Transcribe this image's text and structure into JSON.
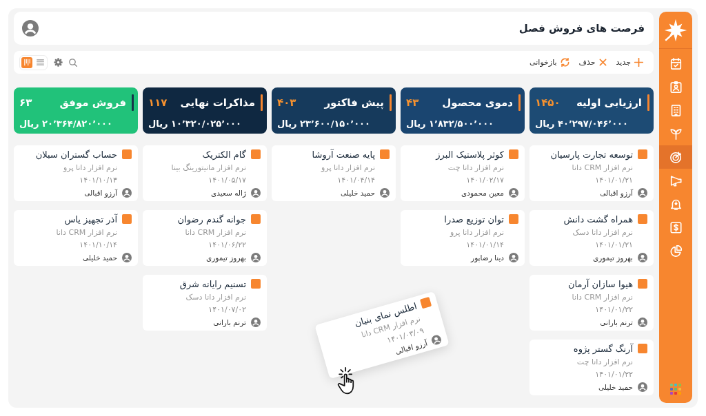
{
  "sidebar": {
    "items": [
      {
        "selected": false
      },
      {
        "selected": false
      },
      {
        "selected": false
      },
      {
        "selected": false
      },
      {
        "selected": true
      },
      {
        "selected": false
      },
      {
        "selected": false
      },
      {
        "selected": false
      },
      {
        "selected": false
      }
    ]
  },
  "header": {
    "title": "فرصت های فروش فصل"
  },
  "toolbar": {
    "actions": [
      {
        "label": "جدید"
      },
      {
        "label": "حذف"
      },
      {
        "label": "بازخوانی"
      }
    ],
    "views": [
      {
        "selected": false
      },
      {
        "selected": true
      }
    ]
  },
  "board": {
    "columns": [
      {
        "title": "ارزیابی اولیه",
        "count": "۱۴۵۰",
        "amount": "۴۰٬۲۹۷/۰۴۶٬۰۰۰ ریال",
        "color": "#1d4b74",
        "kind": "open",
        "cards": [
          {
            "title": "توسعه تجارت پارسیان",
            "product": "نرم افزار CRM دانا",
            "date": "۱۴۰۱/۰۱/۲۱",
            "owner": "آرزو اقبالی"
          },
          {
            "title": "همراه گشت دانش",
            "product": "نرم افزار دانا دسک",
            "date": "۱۴۰۱/۰۱/۲۱",
            "owner": "بهروز تیموری"
          },
          {
            "title": "هیوا سازان آرمان",
            "product": "نرم افزار CRM دانا",
            "date": "۱۴۰۱/۰۱/۲۲",
            "owner": "ترنم بارانی"
          },
          {
            "title": "آرنگ گستر پژوه",
            "product": "نرم افزار دانا چت",
            "date": "۱۴۰۱/۰۱/۲۲",
            "owner": "حمید خلیلی"
          }
        ]
      },
      {
        "title": "دموی محصول",
        "count": "۴۳",
        "amount": "۱٬۸۳۲/۵۰۰٬۰۰۰ ریال",
        "color": "#1a4570",
        "kind": "open",
        "cards": [
          {
            "title": "کوثر پلاستیک البرز",
            "product": "نرم افزار دانا چت",
            "date": "۱۴۰۱/۰۲/۱۷",
            "owner": "معین محمودی"
          },
          {
            "title": "توان توزیع صدرا",
            "product": "نرم افزار دانا پرو",
            "date": "۱۴۰۱/۰۱/۱۴",
            "owner": "دینا رضاپور"
          }
        ]
      },
      {
        "title": "پیش فاکتور",
        "count": "۴۰۳",
        "amount": "۲۳٬۶۰۰/۱۵۰٬۰۰۰ ریال",
        "color": "#163a5c",
        "kind": "open",
        "cards": [
          {
            "title": "پایه صنعت آروشا",
            "product": "نرم افزار دانا پرو",
            "date": "۱۴۰۱/۰۴/۱۴",
            "owner": "حمید خلیلی"
          }
        ]
      },
      {
        "title": "مذاکرات نهایی",
        "count": "۱۱۷",
        "amount": "۱۰٬۳۲۰/۰۲۵٬۰۰۰ ریال",
        "color": "#0f2841",
        "kind": "open",
        "cards": [
          {
            "title": "گام الکتریک",
            "product": "نرم افزار مانیتورینگ بینا",
            "date": "۱۴۰۱/۰۵/۱۷",
            "owner": "ژاله سعیدی"
          },
          {
            "title": "جوانه گندم رضوان",
            "product": "نرم افزار CRM دانا",
            "date": "۱۴۰۱/۰۶/۲۲",
            "owner": "بهروز تیموری"
          },
          {
            "title": "تسنیم رایانه شرق",
            "product": "نرم افزار دانا دسک",
            "date": "۱۴۰۱/۰۷/۰۲",
            "owner": "ترنم بارانی"
          }
        ]
      },
      {
        "title": "فروش موفق",
        "count": "۶۳",
        "amount": "۲۰٬۳۶۴/۸۲۰٬۰۰۰ ریال",
        "color": "#21c27a",
        "kind": "won",
        "cards": [
          {
            "title": "حساب گستران سبلان",
            "product": "نرم افزار دانا پرو",
            "date": "۱۴۰۱/۱۰/۱۳",
            "owner": "آرزو اقبالی"
          },
          {
            "title": "آذر تجهیز یاس",
            "product": "نرم افزار CRM دانا",
            "date": "۱۴۰۱/۱۰/۱۴",
            "owner": "حمید خلیلی"
          }
        ]
      }
    ],
    "dragged_card": {
      "title": "اطلس نمای بنیان",
      "product": "نرم افزار CRM دانا",
      "date": "۱۴۰۱/۰۳/۰۹",
      "owner": "آرزو اقبالی"
    }
  }
}
